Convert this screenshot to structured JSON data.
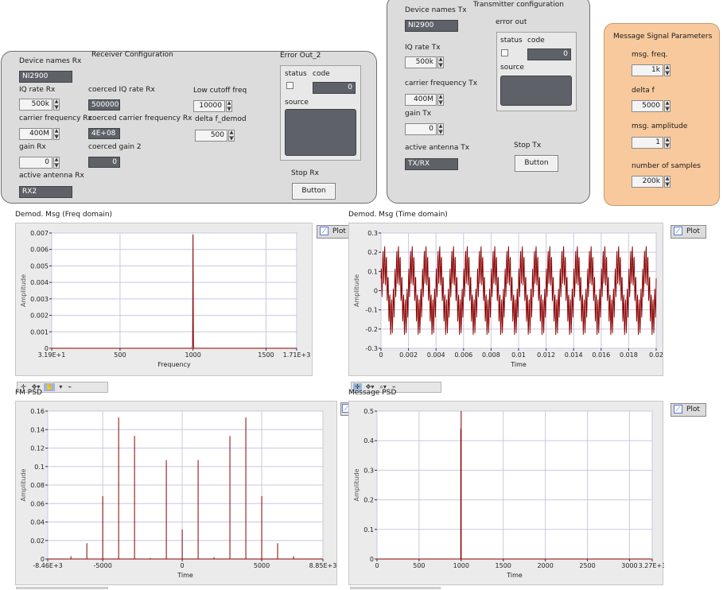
{
  "receiver": {
    "title": "Receiver Configuration",
    "device_names_label": "Device names Rx",
    "device_names_value": "NI2900",
    "iq_rate_label": "IQ rate Rx",
    "iq_rate_value": "500k",
    "carrier_freq_label": "carrier frequency Rx",
    "carrier_freq_value": "400M",
    "gain_label": "gain Rx",
    "gain_value": "0",
    "antenna_label": "active antenna Rx",
    "antenna_value": "RX2",
    "coerced_iq_label": "coerced IQ rate Rx",
    "coerced_iq_value": "500000",
    "coerced_carrier_label": "coerced carrier frequency Rx",
    "coerced_carrier_value": "4E+08",
    "coerced_gain_label": "coerced gain 2",
    "coerced_gain_value": "0",
    "low_cutoff_label": "Low cutoff freq",
    "low_cutoff_value": "10000",
    "delta_demod_label": "delta f_demod",
    "delta_demod_value": "500",
    "error_title": "Error Out_2",
    "status_label": "status",
    "code_label": "code",
    "code_value": "0",
    "source_label": "source",
    "stop_label": "Stop Rx",
    "stop_button": "Button"
  },
  "transmitter": {
    "title": "Transmitter configuration",
    "device_names_label": "Device names Tx",
    "device_names_value": "NI2900",
    "iq_rate_label": "IQ rate Tx",
    "iq_rate_value": "500k",
    "carrier_freq_label": "carrier frequency Tx",
    "carrier_freq_value": "400M",
    "gain_label": "gain Tx",
    "gain_value": "0",
    "antenna_label": "active antenna Tx",
    "antenna_value": "TX/RX",
    "error_title": "error out",
    "status_label": "status",
    "code_label": "code",
    "code_value": "0",
    "source_label": "source",
    "stop_label": "Stop Tx",
    "stop_button": "Button"
  },
  "message": {
    "title": "Message Signal Parameters",
    "freq_label": "msg. freq.",
    "freq_value": "1k",
    "delta_label": "delta f",
    "delta_value": "5000",
    "amp_label": "msg. amplitude",
    "amp_value": "1",
    "samples_label": "number of samples",
    "samples_value": "200k"
  },
  "plot_button_label": "Plot",
  "colors": {
    "panel": "#dcdcdc",
    "message_panel": "#f7c99c",
    "trace": "#8b0000",
    "plot_bg": "#ffffff",
    "grid": "#c8c8e6"
  },
  "chart_data": [
    {
      "id": "demod_freq",
      "title": "Demod. Msg (Freq domain)",
      "type": "line",
      "xlabel": "Frequency",
      "ylabel": "Amplitude",
      "xlim": [
        31.9,
        1710
      ],
      "ylim": [
        0,
        0.007
      ],
      "x_tick_labels": [
        "3.19E+1",
        "500",
        "1000",
        "1500",
        "1.71E+3"
      ],
      "x_ticks": [
        31.9,
        500,
        1000,
        1500,
        1710
      ],
      "y_tick_labels": [
        "0",
        "0.001",
        "0.002",
        "0.003",
        "0.004",
        "0.005",
        "0.006",
        "0.007"
      ],
      "y_ticks": [
        0,
        0.001,
        0.002,
        0.003,
        0.004,
        0.005,
        0.006,
        0.007
      ],
      "x": [
        31.9,
        990,
        995,
        997,
        998,
        999,
        1000,
        1001,
        1002,
        1003,
        1005,
        1010,
        1710
      ],
      "y": [
        0,
        0,
        0,
        0.0002,
        0.0015,
        0.004,
        0.0069,
        0.0038,
        0.0012,
        0.0002,
        0,
        0,
        0
      ],
      "grid": true
    },
    {
      "id": "demod_time",
      "title": "Demod. Msg (Time domain)",
      "type": "line",
      "xlabel": "Time",
      "ylabel": "Amplitude",
      "xlim": [
        0,
        0.02
      ],
      "ylim": [
        -0.3,
        0.3
      ],
      "x_tick_labels": [
        "0",
        "0.002",
        "0.004",
        "0.006",
        "0.008",
        "0.01",
        "0.012",
        "0.014",
        "0.016",
        "0.018",
        "0.02"
      ],
      "x_ticks": [
        0,
        0.002,
        0.004,
        0.006,
        0.008,
        0.01,
        0.012,
        0.014,
        0.016,
        0.018,
        0.02
      ],
      "y_tick_labels": [
        "-0.3",
        "-0.2",
        "-0.1",
        "0",
        "0.1",
        "0.2",
        "0.3"
      ],
      "y_ticks": [
        -0.3,
        -0.2,
        -0.1,
        0,
        0.1,
        0.2,
        0.3
      ],
      "signal": {
        "fundamental_hz": 1000,
        "fundamental_amp": 0.14,
        "ripple_hz": 8000,
        "ripple_amp": 0.1,
        "samples": 800
      },
      "grid": true
    },
    {
      "id": "fm_psd",
      "title": "FM PSD",
      "type": "stem",
      "xlabel": "Time",
      "ylabel": "Amplitude",
      "xlim": [
        -8460,
        8850
      ],
      "ylim": [
        0,
        0.16
      ],
      "x_tick_labels": [
        "-8.46E+3",
        "-5000",
        "0",
        "5000",
        "8.85E+3"
      ],
      "x_ticks": [
        -8460,
        -5000,
        0,
        5000,
        8850
      ],
      "y_tick_labels": [
        "0",
        "0.02",
        "0.04",
        "0.06",
        "0.08",
        "0.1",
        "0.12",
        "0.14",
        "0.16"
      ],
      "y_ticks": [
        0,
        0.02,
        0.04,
        0.06,
        0.08,
        0.1,
        0.12,
        0.14,
        0.16
      ],
      "x": [
        -7000,
        -6000,
        -5000,
        -4000,
        -3000,
        -2000,
        -1000,
        0,
        1000,
        2000,
        3000,
        4000,
        5000,
        6000,
        7000
      ],
      "y": [
        0.003,
        0.017,
        0.068,
        0.153,
        0.133,
        0.001,
        0.107,
        0.032,
        0.107,
        0.002,
        0.133,
        0.153,
        0.068,
        0.017,
        0.003
      ],
      "grid": true
    },
    {
      "id": "message_psd",
      "title": "Message PSD",
      "type": "stem",
      "xlabel": "Time",
      "ylabel": "Amplitude",
      "xlim": [
        0,
        3270
      ],
      "ylim": [
        0,
        0.5
      ],
      "x_tick_labels": [
        "0",
        "500",
        "1000",
        "1500",
        "2000",
        "2500",
        "3000",
        "3.27E+3"
      ],
      "x_ticks": [
        0,
        500,
        1000,
        1500,
        2000,
        2500,
        3000,
        3270
      ],
      "y_tick_labels": [
        "0",
        "0.1",
        "0.2",
        "0.3",
        "0.4",
        "0.5"
      ],
      "y_ticks": [
        0,
        0.1,
        0.2,
        0.3,
        0.4,
        0.5
      ],
      "x": [
        995,
        1000,
        1005
      ],
      "y": [
        0.44,
        0.5,
        0.0
      ],
      "grid": true
    }
  ]
}
